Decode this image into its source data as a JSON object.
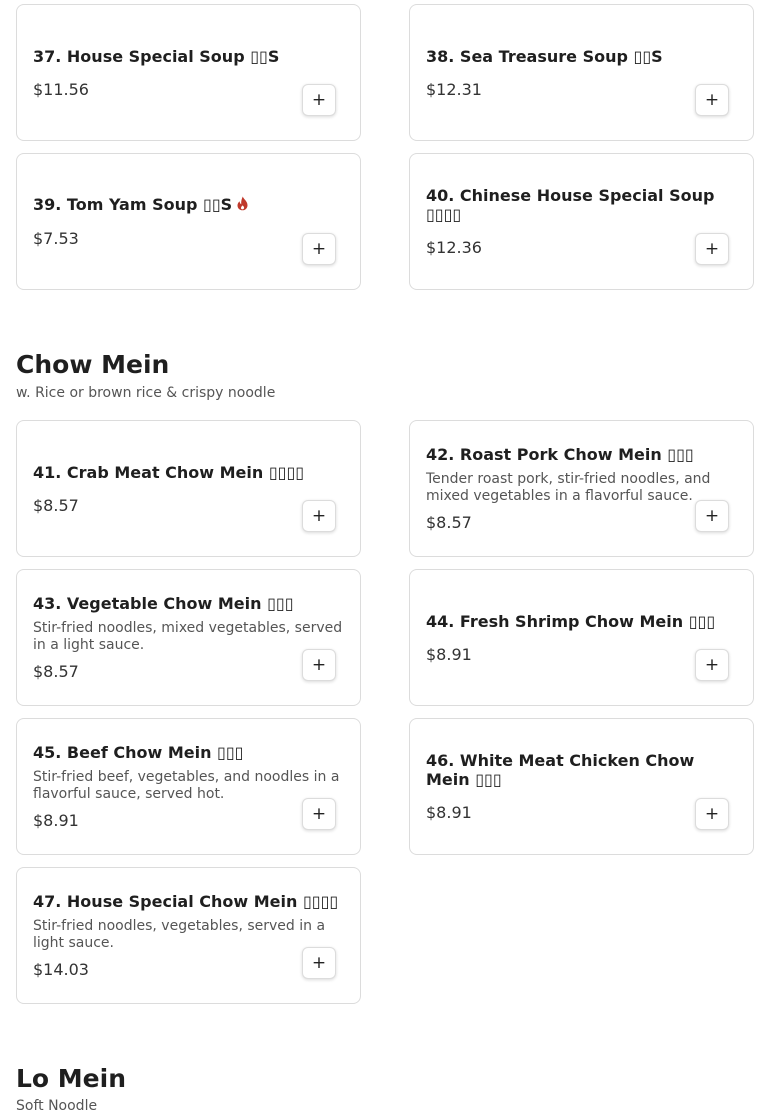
{
  "colors": {
    "border": "#dcdcdc",
    "spicy": "#c0392b",
    "text": "#1f1f1f",
    "muted": "#555555"
  },
  "add_label": "+",
  "soups": {
    "items": [
      {
        "name": "37. House Special Soup ▯▯S",
        "price": "$11.56"
      },
      {
        "name": "38. Sea Treasure Soup ▯▯S",
        "price": "$12.31"
      },
      {
        "name": "39. Tom Yam Soup ▯▯S",
        "price": "$7.53",
        "icon": "fire-icon"
      },
      {
        "name": "40. Chinese House Special Soup ▯▯▯▯",
        "price": "$12.36"
      }
    ]
  },
  "chow_mein": {
    "title": "Chow Mein",
    "subtitle": "w. Rice or brown rice & crispy noodle",
    "items": [
      {
        "name": "41. Crab Meat Chow Mein ▯▯▯▯",
        "price": "$8.57"
      },
      {
        "name": "42. Roast Pork Chow Mein ▯▯▯",
        "desc": "Tender roast pork, stir-fried noodles, and mixed vegetables in a flavorful sauce.",
        "price": "$8.57"
      },
      {
        "name": "43. Vegetable Chow Mein ▯▯▯",
        "desc": "Stir-fried noodles, mixed vegetables, served in a light sauce.",
        "price": "$8.57"
      },
      {
        "name": "44. Fresh Shrimp Chow Mein ▯▯▯",
        "price": "$8.91"
      },
      {
        "name": "45. Beef Chow Mein ▯▯▯",
        "desc": "Stir-fried beef, vegetables, and noodles in a flavorful sauce, served hot.",
        "price": "$8.91"
      },
      {
        "name": "46. White Meat Chicken Chow Mein ▯▯▯",
        "price": "$8.91"
      },
      {
        "name": "47. House Special Chow Mein ▯▯▯▯",
        "desc": "Stir-fried noodles, vegetables, served in a light sauce.",
        "price": "$14.03"
      }
    ]
  },
  "lo_mein": {
    "title": "Lo Mein",
    "subtitle": "Soft Noodle"
  }
}
